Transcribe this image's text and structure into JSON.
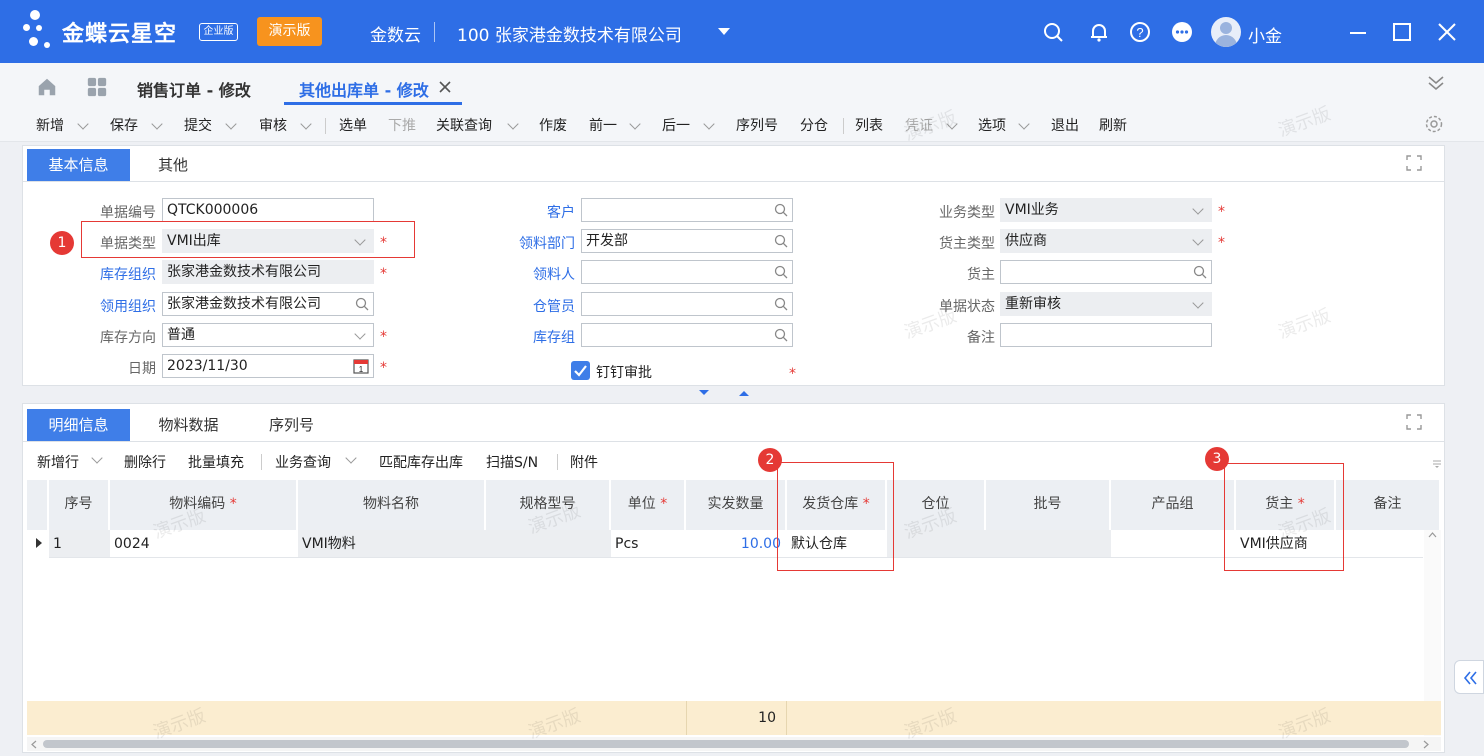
{
  "titlebar": {
    "brand": "金蝶云星空",
    "edition": "企业版",
    "demo_badge": "演示版",
    "app_name": "金数云",
    "company": "100  张家港金数技术有限公司",
    "username": "小金"
  },
  "tabs": [
    {
      "label": "销售订单 - 修改"
    },
    {
      "label": "其他出库单 - 修改"
    }
  ],
  "toolbar": [
    {
      "label": "新增",
      "dropdown": true
    },
    {
      "label": "保存",
      "dropdown": true
    },
    {
      "label": "提交",
      "dropdown": true
    },
    {
      "label": "审核",
      "dropdown": true
    },
    {
      "label": "选单",
      "dropdown": false
    },
    {
      "label": "下推",
      "dropdown": false,
      "disabled": true
    },
    {
      "label": "关联查询",
      "dropdown": true
    },
    {
      "label": "作废",
      "dropdown": false
    },
    {
      "label": "前一",
      "dropdown": true
    },
    {
      "label": "后一",
      "dropdown": true
    },
    {
      "label": "序列号",
      "dropdown": false
    },
    {
      "label": "分仓",
      "dropdown": false
    },
    {
      "label": "列表",
      "dropdown": false
    },
    {
      "label": "凭证",
      "dropdown": true,
      "disabled": true
    },
    {
      "label": "选项",
      "dropdown": true
    },
    {
      "label": "退出",
      "dropdown": false
    },
    {
      "label": "刷新",
      "dropdown": false
    }
  ],
  "header_panel": {
    "tabs": [
      "基本信息",
      "其他"
    ],
    "fields": {
      "bill_no": {
        "label": "单据编号",
        "value": "QTCK000006"
      },
      "bill_type": {
        "label": "单据类型",
        "value": "VMI出库"
      },
      "stock_org": {
        "label": "库存组织",
        "value": "张家港金数技术有限公司"
      },
      "pick_org": {
        "label": "领用组织",
        "value": "张家港金数技术有限公司"
      },
      "stock_direction": {
        "label": "库存方向",
        "value": "普通"
      },
      "date": {
        "label": "日期",
        "value": "2023/11/30"
      },
      "customer": {
        "label": "客户",
        "value": ""
      },
      "dept": {
        "label": "领料部门",
        "value": "开发部"
      },
      "picker": {
        "label": "领料人",
        "value": ""
      },
      "stocker": {
        "label": "仓管员",
        "value": ""
      },
      "stock_group": {
        "label": "库存组",
        "value": ""
      },
      "dingtalk": {
        "label": "钉钉审批",
        "checked": true
      },
      "biz_type": {
        "label": "业务类型",
        "value": "VMI业务"
      },
      "owner_type": {
        "label": "货主类型",
        "value": "供应商"
      },
      "owner": {
        "label": "货主",
        "value": ""
      },
      "status": {
        "label": "单据状态",
        "value": "重新审核"
      },
      "note": {
        "label": "备注",
        "value": ""
      }
    }
  },
  "detail_panel": {
    "tabs": [
      "明细信息",
      "物料数据",
      "序列号"
    ],
    "toolbar": [
      "新增行",
      "删除行",
      "批量填充",
      "业务查询",
      "匹配库存出库",
      "扫描S/N",
      "附件"
    ],
    "columns": [
      "序号",
      "物料编码",
      "物料名称",
      "规格型号",
      "单位",
      "实发数量",
      "发货仓库",
      "仓位",
      "批号",
      "产品组",
      "货主",
      "备注"
    ],
    "rows": [
      [
        "1",
        "0024",
        "VMI物料",
        "",
        "Pcs",
        "10.00",
        "默认仓库",
        "",
        "",
        "",
        "VMI供应商",
        ""
      ]
    ],
    "total_qty": "10"
  },
  "annotations": [
    "1",
    "2",
    "3"
  ],
  "watermark": "演示版",
  "colors": {
    "primary": "#2e6ee6",
    "badge": "#f7931e",
    "required": "#e53935",
    "footer": "#fbedd0"
  }
}
